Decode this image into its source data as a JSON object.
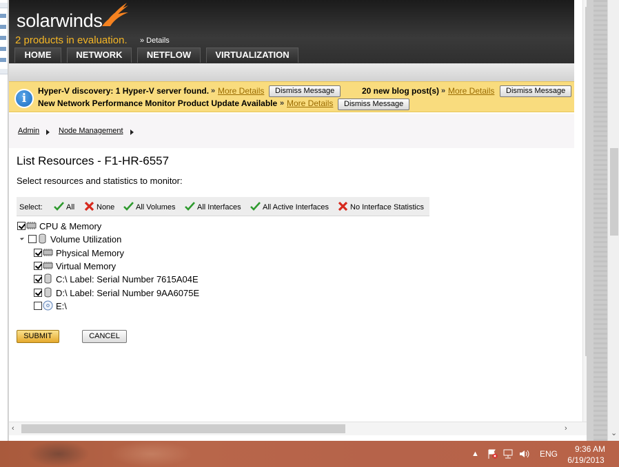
{
  "header": {
    "logo": "solarwinds",
    "evaluation": "2 products in evaluation.",
    "evaluation_detail": "» Details",
    "nav": [
      "HOME",
      "NETWORK",
      "NETFLOW",
      "VIRTUALIZATION"
    ]
  },
  "notifications": {
    "msg1": "Hyper-V discovery: 1 Hyper-V server found.",
    "msg2": "20 new blog post(s)",
    "msg3": "New Network Performance Monitor Product Update Available",
    "raquo": "»",
    "more": "More Details",
    "dismiss": "Dismiss Message"
  },
  "breadcrumb": [
    "Admin",
    "Node Management"
  ],
  "page": {
    "title": "List Resources - F1-HR-6557",
    "subtitle": "Select resources and statistics to monitor:"
  },
  "select_bar": {
    "label": "Select:",
    "options": [
      "All",
      "None",
      "All Volumes",
      "All Interfaces",
      "All Active Interfaces",
      "No Interface Statistics"
    ]
  },
  "tree": [
    {
      "label": "CPU & Memory",
      "checked": true
    },
    {
      "label": "Volume Utilization",
      "checked": false
    },
    {
      "label": "Physical Memory",
      "checked": true
    },
    {
      "label": "Virtual Memory",
      "checked": true
    },
    {
      "label": "C:\\ Label: Serial Number 7615A04E",
      "checked": true
    },
    {
      "label": "D:\\ Label: Serial Number 9AA6075E",
      "checked": true
    },
    {
      "label": "E:\\",
      "checked": false
    }
  ],
  "buttons": {
    "submit": "SUBMIT",
    "cancel": "CANCEL"
  },
  "taskbar": {
    "lang": "ENG",
    "time": "9:36 AM",
    "date": "6/19/2013"
  },
  "colors": {
    "accent": "#f5b625",
    "notify_bg": "#f9dc7e",
    "header_bg": "#2f2f2f",
    "taskbar": "#b6634a"
  }
}
